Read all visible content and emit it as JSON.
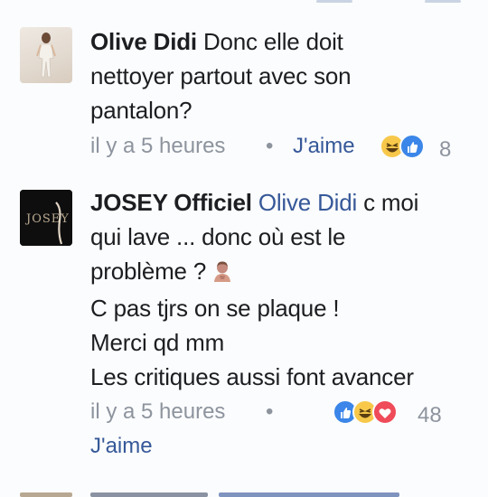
{
  "comments": [
    {
      "author": "Olive Didi",
      "lines": [
        "Donc elle doit",
        "nettoyer partout avec son",
        "pantalon?"
      ],
      "time": "il y a 5 heures",
      "like_label": "J'aime",
      "reaction_count": "8",
      "reactions": [
        "haha-reaction-icon",
        "like-reaction-icon"
      ]
    },
    {
      "author": "JOSEY Officiel",
      "mention": "Olive Didi",
      "lines": [
        "c moi",
        "qui lave ... donc où est le",
        "problème ?",
        "C pas tjrs on se plaque !",
        "Merci qd mm",
        "Les critiques aussi font avancer"
      ],
      "avatar_text": "JOSEY",
      "time": "il y a 5 heures",
      "like_label": "J'aime",
      "reaction_count": "48",
      "reactions": [
        "like-reaction-icon",
        "haha-reaction-icon",
        "love-reaction-icon"
      ]
    }
  ],
  "separator": "•",
  "colors": {
    "link": "#365899",
    "meta": "#8d949e",
    "text": "#1c1e21"
  }
}
